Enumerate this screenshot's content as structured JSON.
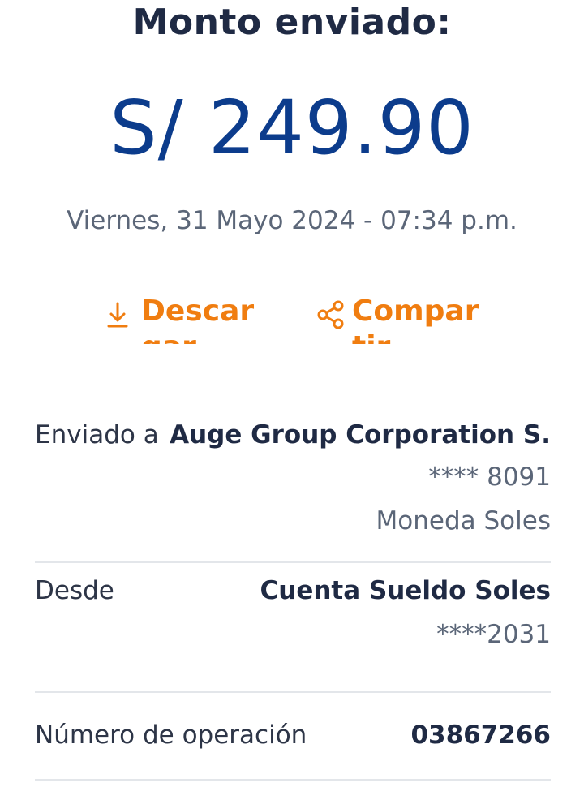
{
  "header": {
    "title": "Monto enviado:",
    "amount": "S/ 249.90",
    "datetime": "Viernes, 31 Mayo 2024 - 07:34 p.m."
  },
  "actions": {
    "download_label": "Descargar",
    "share_label": "Compartir",
    "download_icon": "download-icon",
    "share_icon": "share-icon"
  },
  "details": {
    "sent_to": {
      "label": "Enviado a",
      "name": "Auge Group Corporation S.",
      "account": "**** 8091",
      "currency": "Moneda Soles"
    },
    "from": {
      "label": "Desde",
      "account_name": "Cuenta Sueldo Soles",
      "account_number": "****2031"
    },
    "operation": {
      "label": "Número de operación",
      "number": "03867266"
    }
  },
  "colors": {
    "amount": "#0c3c8c",
    "accent": "#f07d10",
    "text_dark": "#1f2a44",
    "text_muted": "#5b6678",
    "divider": "#e3e6ea"
  }
}
